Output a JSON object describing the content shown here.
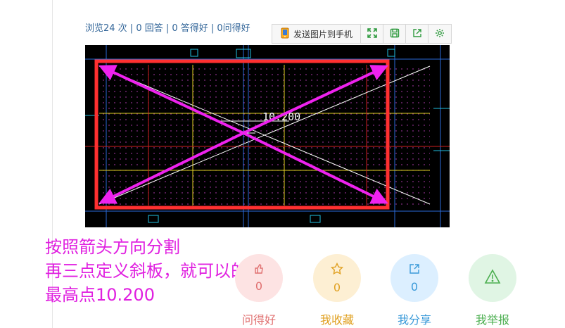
{
  "question": {
    "stats_text": "浏览24 次 | 0 回答 | 0 答得好 | 0问得好"
  },
  "image_toolbar": {
    "send_label": "发送图片到手机",
    "buttons": [
      {
        "icon": "phone-icon"
      },
      {
        "icon": "expand-icon"
      },
      {
        "icon": "save-icon"
      },
      {
        "icon": "share-icon"
      },
      {
        "icon": "settings-icon"
      }
    ]
  },
  "cad_image": {
    "elevation_label": "10.200"
  },
  "annotation": {
    "line1": "按照箭头方向分割",
    "line2": "再三点定义斜板，就可以的吧",
    "line3": "最高点10.200"
  },
  "actions": [
    {
      "label": "问得好",
      "count": "0",
      "icon": "thumb-icon",
      "color": "#e07070",
      "bg": "#fde3e3"
    },
    {
      "label": "我收藏",
      "count": "0",
      "icon": "star-icon",
      "color": "#e0a020",
      "bg": "#fdefd3"
    },
    {
      "label": "我分享",
      "count": "0",
      "icon": "share-icon",
      "color": "#3a9ad9",
      "bg": "#dcefff"
    },
    {
      "label": "我举报",
      "count": "",
      "icon": "warning-icon",
      "color": "#4caf50",
      "bg": "#e0f5e4"
    }
  ],
  "colors": {
    "link_blue": "#336699",
    "annotation_magenta": "#e020e0",
    "frame_red": "#ff3030"
  }
}
